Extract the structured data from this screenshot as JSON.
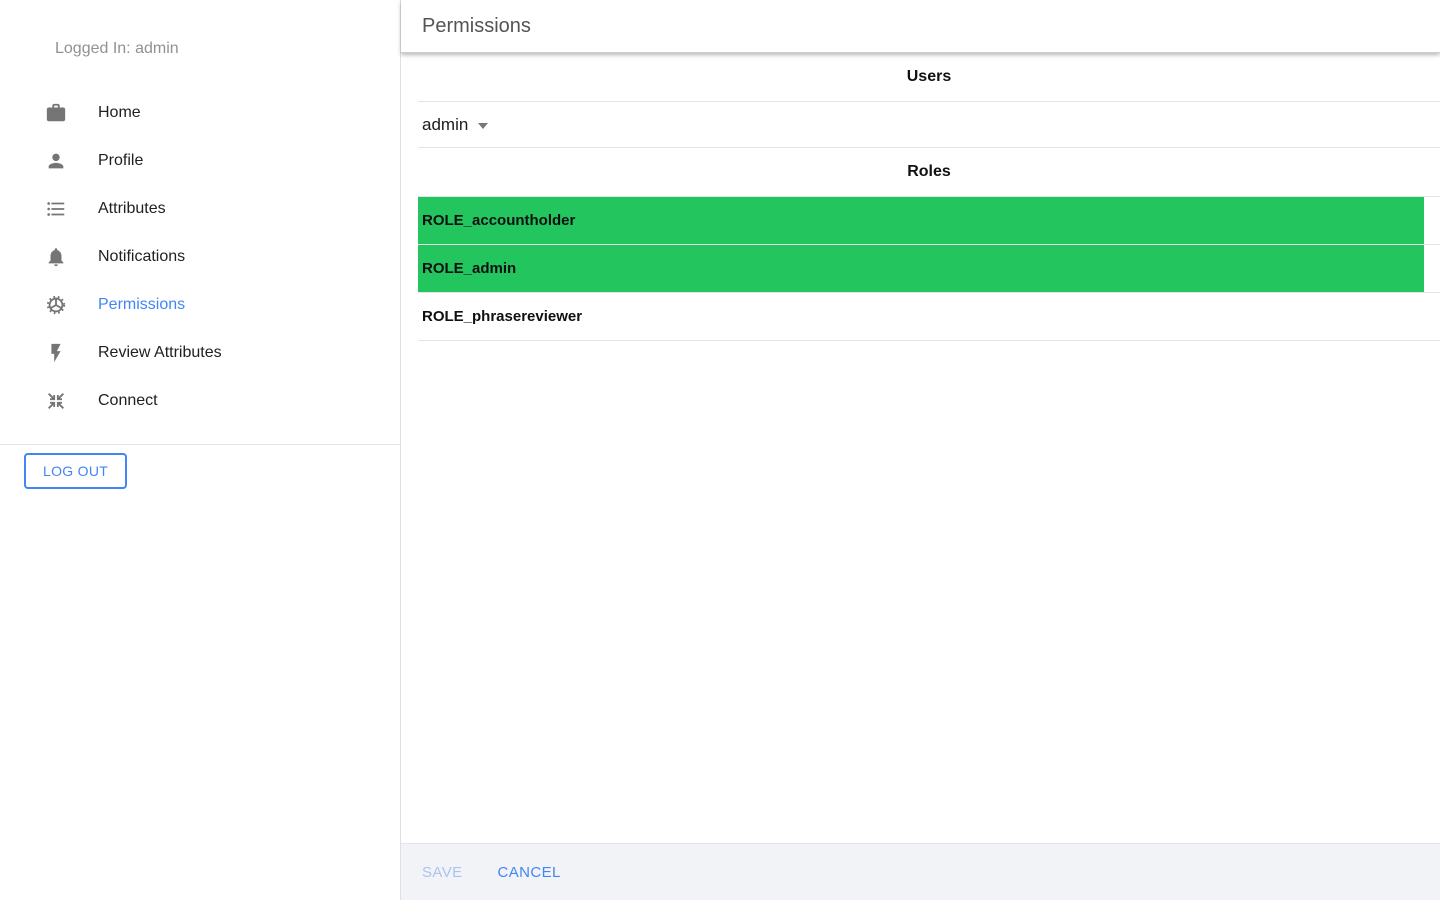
{
  "sidebar": {
    "logged_in": "Logged In: admin",
    "items": [
      {
        "label": "Home",
        "icon": "work-icon",
        "active": false
      },
      {
        "label": "Profile",
        "icon": "person-icon",
        "active": false
      },
      {
        "label": "Attributes",
        "icon": "list-icon",
        "active": false
      },
      {
        "label": "Notifications",
        "icon": "bell-icon",
        "active": false
      },
      {
        "label": "Permissions",
        "icon": "gear-icon",
        "active": true
      },
      {
        "label": "Review Attributes",
        "icon": "bolt-icon",
        "active": false
      },
      {
        "label": "Connect",
        "icon": "collapse-icon",
        "active": false
      }
    ],
    "logout_label": "LOG OUT"
  },
  "main": {
    "title": "Permissions",
    "users_heading": "Users",
    "selected_user": "admin",
    "roles_heading": "Roles",
    "roles": [
      {
        "name": "ROLE_accountholder",
        "selected": true
      },
      {
        "name": "ROLE_admin",
        "selected": true
      },
      {
        "name": "ROLE_phrasereviewer",
        "selected": false
      }
    ]
  },
  "footer": {
    "save_label": "SAVE",
    "cancel_label": "CANCEL",
    "save_enabled": false
  },
  "colors": {
    "accent_blue": "#4285f4",
    "disabled_blue": "#a9c3f2",
    "selected_green": "#22c55e"
  }
}
